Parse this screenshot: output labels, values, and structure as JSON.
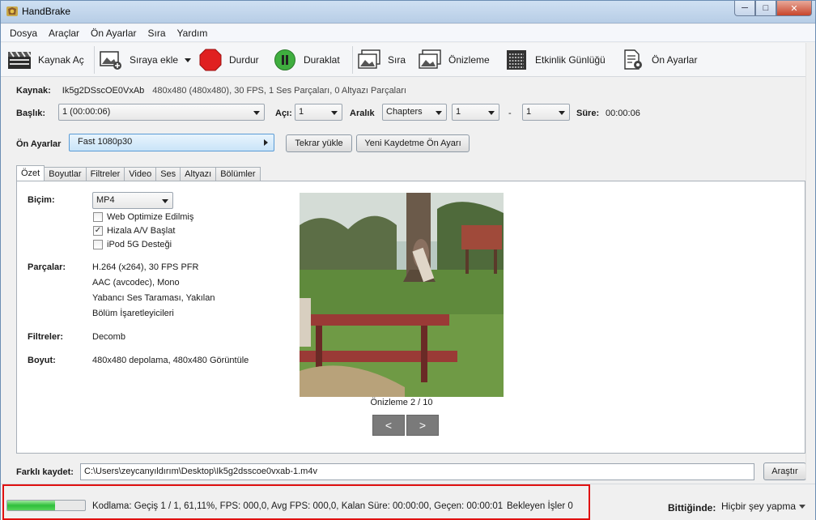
{
  "window": {
    "title": "HandBrake",
    "min": "─",
    "max": "□",
    "close": "✕"
  },
  "menu": [
    "Dosya",
    "Araçlar",
    "Ön Ayarlar",
    "Sıra",
    "Yardım"
  ],
  "toolbar": {
    "open_source": "Kaynak Aç",
    "add_to_queue": "Sıraya ekle",
    "stop": "Durdur",
    "pause": "Duraklat",
    "queue": "Sıra",
    "preview": "Önizleme",
    "activity_log": "Etkinlik Günlüğü",
    "presets": "Ön Ayarlar"
  },
  "source": {
    "label": "Kaynak:",
    "name": "Ik5g2DSscOE0VxAb",
    "info": "480x480 (480x480), 30 FPS, 1 Ses Parçaları, 0 Altyazı Parçaları"
  },
  "title_row": {
    "title_label": "Başlık:",
    "title_value": "1 (00:00:06)",
    "angle_label": "Açı:",
    "angle_value": "1",
    "range_label": "Aralık",
    "range_mode": "Chapters",
    "range_start": "1",
    "dash": "-",
    "range_end": "1",
    "duration_label": "Süre:",
    "duration_value": "00:00:06"
  },
  "presets_row": {
    "label": "Ön Ayarlar",
    "value": "Fast 1080p30",
    "reload": "Tekrar yükle",
    "save_new": "Yeni Kaydetme Ön Ayarı"
  },
  "tabs": [
    "Özet",
    "Boyutlar",
    "Filtreler",
    "Video",
    "Ses",
    "Altyazı",
    "Bölümler"
  ],
  "summary": {
    "format_label": "Biçim:",
    "format_value": "MP4",
    "web_optimized": "Web Optimize Edilmiş",
    "align_av": "Hizala A/V Başlat",
    "ipod": "iPod 5G Desteği",
    "tracks_label": "Parçalar:",
    "tracks": [
      "H.264 (x264), 30 FPS PFR",
      "AAC (avcodec), Mono",
      "Yabancı Ses Taraması, Yakılan",
      "Bölüm İşaretleyicileri"
    ],
    "filters_label": "Filtreler:",
    "filters_value": "Decomb",
    "size_label": "Boyut:",
    "size_value": "480x480 depolama, 480x480 Görüntüle",
    "preview_caption": "Önizleme 2 / 10",
    "prev": "<",
    "next": ">"
  },
  "save_as": {
    "label": "Farklı kaydet:",
    "path": "C:\\Users\\zeycanyıldırım\\Desktop\\Ik5g2dsscoe0vxab-1.m4v",
    "browse": "Araştır"
  },
  "status": {
    "progress_fraction": 0.6111,
    "encoding_text": "Kodlama: Geçiş 1 / 1,  61,11%, FPS: 000,0,  Avg FPS: 000,0,  Kalan Süre: 00:00:00,  Geçen: 00:00:01",
    "pending_jobs": "Bekleyen İşler 0",
    "when_done_label": "Bittiğinde:",
    "when_done_value": "Hiçbir şey yapma"
  },
  "colors": {
    "accent_red": "#e01010",
    "progress_green": "#2fbf3b",
    "stop_red": "#e02020",
    "pause_green": "#3fae3f"
  }
}
